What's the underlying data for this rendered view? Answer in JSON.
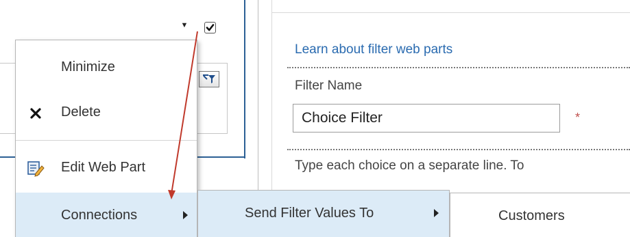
{
  "tool_pane": {
    "link": "Learn about filter web parts",
    "filter_name_label": "Filter Name",
    "filter_name_value": "Choice Filter",
    "required_marker": "*",
    "help_text": "Type each choice on a separate line. To"
  },
  "context_menu": {
    "items": [
      {
        "label": "Minimize",
        "icon": ""
      },
      {
        "label": "Delete",
        "icon": "close-icon"
      },
      {
        "label": "Edit Web Part",
        "icon": "edit-web-part-icon"
      },
      {
        "label": "Connections",
        "icon": "",
        "has_submenu": true
      }
    ]
  },
  "submenu_connections": {
    "label": "Send Filter Values To",
    "has_submenu": true
  },
  "submenu_targets": {
    "label": "Customers"
  },
  "web_part": {
    "dropdown_icon": "dropdown-arrow-icon",
    "checkbox_checked": true,
    "filter_button_icon": "filter-icon"
  },
  "colors": {
    "link": "#2a6bb0",
    "highlight": "#dcebf7",
    "frame": "#2b5f94",
    "annotation": "#c0392b"
  }
}
